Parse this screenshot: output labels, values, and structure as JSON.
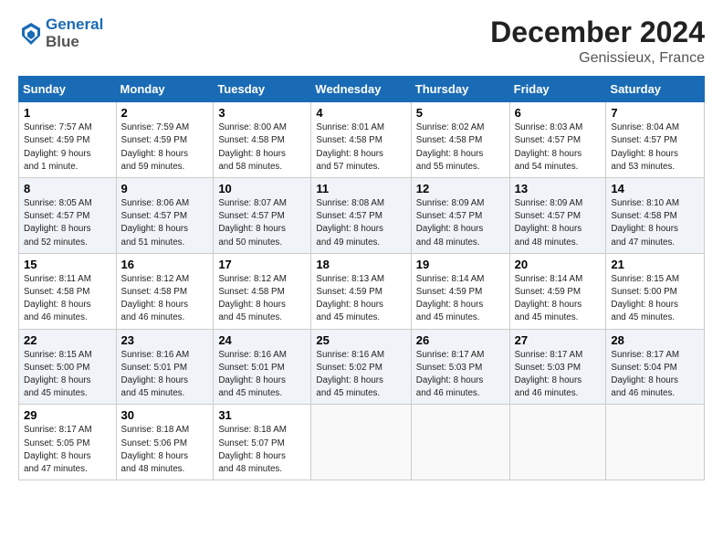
{
  "header": {
    "logo_line1": "General",
    "logo_line2": "Blue",
    "month": "December 2024",
    "location": "Genissieux, France"
  },
  "days_of_week": [
    "Sunday",
    "Monday",
    "Tuesday",
    "Wednesday",
    "Thursday",
    "Friday",
    "Saturday"
  ],
  "weeks": [
    [
      {
        "day": "1",
        "info": "Sunrise: 7:57 AM\nSunset: 4:59 PM\nDaylight: 9 hours\nand 1 minute."
      },
      {
        "day": "2",
        "info": "Sunrise: 7:59 AM\nSunset: 4:59 PM\nDaylight: 8 hours\nand 59 minutes."
      },
      {
        "day": "3",
        "info": "Sunrise: 8:00 AM\nSunset: 4:58 PM\nDaylight: 8 hours\nand 58 minutes."
      },
      {
        "day": "4",
        "info": "Sunrise: 8:01 AM\nSunset: 4:58 PM\nDaylight: 8 hours\nand 57 minutes."
      },
      {
        "day": "5",
        "info": "Sunrise: 8:02 AM\nSunset: 4:58 PM\nDaylight: 8 hours\nand 55 minutes."
      },
      {
        "day": "6",
        "info": "Sunrise: 8:03 AM\nSunset: 4:57 PM\nDaylight: 8 hours\nand 54 minutes."
      },
      {
        "day": "7",
        "info": "Sunrise: 8:04 AM\nSunset: 4:57 PM\nDaylight: 8 hours\nand 53 minutes."
      }
    ],
    [
      {
        "day": "8",
        "info": "Sunrise: 8:05 AM\nSunset: 4:57 PM\nDaylight: 8 hours\nand 52 minutes."
      },
      {
        "day": "9",
        "info": "Sunrise: 8:06 AM\nSunset: 4:57 PM\nDaylight: 8 hours\nand 51 minutes."
      },
      {
        "day": "10",
        "info": "Sunrise: 8:07 AM\nSunset: 4:57 PM\nDaylight: 8 hours\nand 50 minutes."
      },
      {
        "day": "11",
        "info": "Sunrise: 8:08 AM\nSunset: 4:57 PM\nDaylight: 8 hours\nand 49 minutes."
      },
      {
        "day": "12",
        "info": "Sunrise: 8:09 AM\nSunset: 4:57 PM\nDaylight: 8 hours\nand 48 minutes."
      },
      {
        "day": "13",
        "info": "Sunrise: 8:09 AM\nSunset: 4:57 PM\nDaylight: 8 hours\nand 48 minutes."
      },
      {
        "day": "14",
        "info": "Sunrise: 8:10 AM\nSunset: 4:58 PM\nDaylight: 8 hours\nand 47 minutes."
      }
    ],
    [
      {
        "day": "15",
        "info": "Sunrise: 8:11 AM\nSunset: 4:58 PM\nDaylight: 8 hours\nand 46 minutes."
      },
      {
        "day": "16",
        "info": "Sunrise: 8:12 AM\nSunset: 4:58 PM\nDaylight: 8 hours\nand 46 minutes."
      },
      {
        "day": "17",
        "info": "Sunrise: 8:12 AM\nSunset: 4:58 PM\nDaylight: 8 hours\nand 45 minutes."
      },
      {
        "day": "18",
        "info": "Sunrise: 8:13 AM\nSunset: 4:59 PM\nDaylight: 8 hours\nand 45 minutes."
      },
      {
        "day": "19",
        "info": "Sunrise: 8:14 AM\nSunset: 4:59 PM\nDaylight: 8 hours\nand 45 minutes."
      },
      {
        "day": "20",
        "info": "Sunrise: 8:14 AM\nSunset: 4:59 PM\nDaylight: 8 hours\nand 45 minutes."
      },
      {
        "day": "21",
        "info": "Sunrise: 8:15 AM\nSunset: 5:00 PM\nDaylight: 8 hours\nand 45 minutes."
      }
    ],
    [
      {
        "day": "22",
        "info": "Sunrise: 8:15 AM\nSunset: 5:00 PM\nDaylight: 8 hours\nand 45 minutes."
      },
      {
        "day": "23",
        "info": "Sunrise: 8:16 AM\nSunset: 5:01 PM\nDaylight: 8 hours\nand 45 minutes."
      },
      {
        "day": "24",
        "info": "Sunrise: 8:16 AM\nSunset: 5:01 PM\nDaylight: 8 hours\nand 45 minutes."
      },
      {
        "day": "25",
        "info": "Sunrise: 8:16 AM\nSunset: 5:02 PM\nDaylight: 8 hours\nand 45 minutes."
      },
      {
        "day": "26",
        "info": "Sunrise: 8:17 AM\nSunset: 5:03 PM\nDaylight: 8 hours\nand 46 minutes."
      },
      {
        "day": "27",
        "info": "Sunrise: 8:17 AM\nSunset: 5:03 PM\nDaylight: 8 hours\nand 46 minutes."
      },
      {
        "day": "28",
        "info": "Sunrise: 8:17 AM\nSunset: 5:04 PM\nDaylight: 8 hours\nand 46 minutes."
      }
    ],
    [
      {
        "day": "29",
        "info": "Sunrise: 8:17 AM\nSunset: 5:05 PM\nDaylight: 8 hours\nand 47 minutes."
      },
      {
        "day": "30",
        "info": "Sunrise: 8:18 AM\nSunset: 5:06 PM\nDaylight: 8 hours\nand 48 minutes."
      },
      {
        "day": "31",
        "info": "Sunrise: 8:18 AM\nSunset: 5:07 PM\nDaylight: 8 hours\nand 48 minutes."
      },
      {
        "day": "",
        "info": ""
      },
      {
        "day": "",
        "info": ""
      },
      {
        "day": "",
        "info": ""
      },
      {
        "day": "",
        "info": ""
      }
    ]
  ]
}
